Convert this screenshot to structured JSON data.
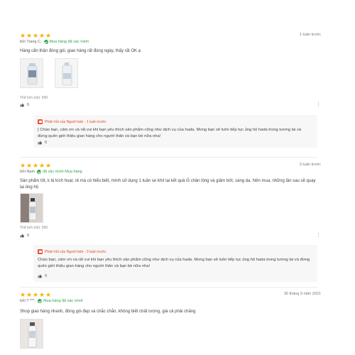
{
  "reviews": [
    {
      "stars": 5,
      "date": "1 tuần trước",
      "author": "bởi Trang C.",
      "verified": "Mua hàng đã xác minh",
      "text": "Hàng cẩn thận đóng gói, giao hàng rất đúng ngày, thấy rất OK ạ",
      "variant": "Thể tích (ml): 500",
      "likes": "0",
      "reply": {
        "header": "Phản hồi của Người bán - 1 tuần trước",
        "text": "[ Chào bạn, cảm ơn và rất vui khi bạn yêu thích sản phẩm cũng như dịch vụ của hada. Mong bạn sẽ luôn tiếp tục ủng hộ hada trong tương lai và đừng quên giới thiệu gian hàng cho người thân và bạn bè nữa nha!",
        "likes": "0"
      }
    },
    {
      "stars": 5,
      "date": "3 tuần trước",
      "author": "bởi Nam",
      "verified": "đã xác minh Mua hàng",
      "text": "Sản phẩm tốt, k bị kích hoạt, rẻ mà có hiểu biết, mình sử dụng 1 tuần se khít lại kết quả lỗ chân lông và giảm bớt, sáng da. Nên mua, những lần sau sẽ quay lại ủng hộ",
      "variant": "Thể tích (ml): 500",
      "likes": "0",
      "reply": {
        "header": "Phản hồi của Người bán - 3 tuần trước",
        "text": "Chào bạn, cảm ơn và rất vui khi bạn yêu thích sản phẩm cũng như dịch vụ của hada. Mong bạn sẽ luôn tiếp tục ủng hộ hada trong tương lai và đừng quên giới thiệu gian hàng cho người thân và bạn bè nữa nha!",
        "likes": "0"
      }
    },
    {
      "stars": 5,
      "date": "30 tháng 9 năm 2021",
      "author": "bởi T ***.",
      "verified": "Mua hàng đã xác minh",
      "text": "Shop giao hàng nhanh, đóng gói đẹp và chắc chắn, không biết chất lượng, giá cả phải chăng"
    }
  ],
  "colors": {
    "star": "#f5b300",
    "verified": "#2ea44f",
    "seller": "#e04a2a"
  },
  "icons": {
    "star": "star-icon",
    "like": "thumb-up-icon",
    "more": "more-icon",
    "verified": "check-circle-icon",
    "seller": "shop-icon"
  }
}
